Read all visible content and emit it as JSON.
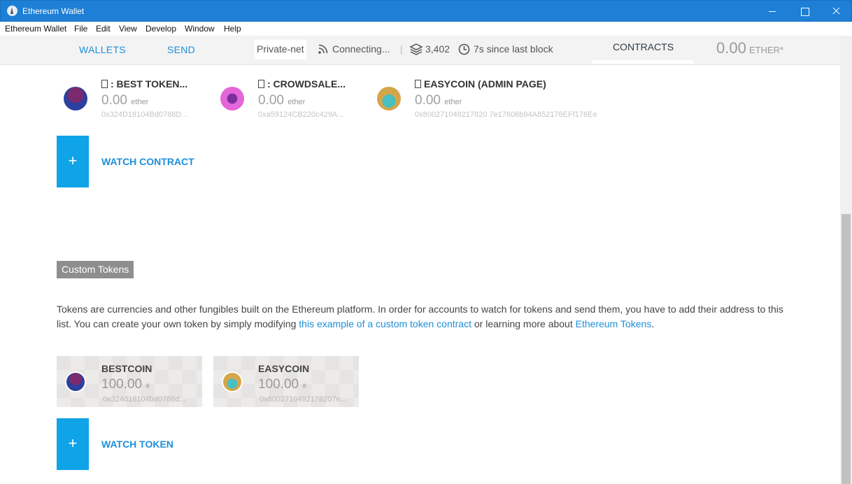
{
  "window": {
    "title": "Ethereum Wallet"
  },
  "menu": [
    "Ethereum Wallet",
    "File",
    "Edit",
    "View",
    "Develop",
    "Window",
    "Help"
  ],
  "nav": {
    "wallets": "WALLETS",
    "send": "SEND",
    "network": "Private-net",
    "connection": "Connecting...",
    "separator": "|",
    "block_number": "3,402",
    "last_block": "7s since last block",
    "contracts": "CONTRACTS",
    "balance": "0.00",
    "balance_unit": "ETHER*"
  },
  "contracts": [
    {
      "name": ": BEST TOKEN...",
      "amount": "0.00",
      "unit": "ether",
      "address": "0x324D18104Bd0788D..."
    },
    {
      "name": ": CROWDSALE...",
      "amount": "0.00",
      "unit": "ether",
      "address": "0xa59124CB220c429A..."
    },
    {
      "name": "EASYCOIN (ADMIN PAGE)",
      "amount": "0.00",
      "unit": "ether",
      "address": "0x800271049217820 7e17606b94A852176EFf176Ee"
    }
  ],
  "watch_contract": {
    "plus": "+",
    "label": "WATCH CONTRACT"
  },
  "custom_tokens": {
    "heading": "Custom Tokens",
    "desc_part1": "Tokens are currencies and other fungibles built on the Ethereum platform. In order for accounts to watch for tokens and send them, you have to add their address to this list. You can create your own token by simply modifying ",
    "link1": "this example of a custom token contract",
    "desc_part2": " or learning more about ",
    "link2": "Ethereum Tokens",
    "desc_part3": ".",
    "tokens": [
      {
        "name": "BESTCOIN",
        "amount": "100.00",
        "symbol": "#",
        "address": "0x324d18104bd0788d..."
      },
      {
        "name": "EASYCOIN",
        "amount": "100.00",
        "symbol": "#",
        "address": "0x8002710492178207e..."
      }
    ]
  },
  "watch_token": {
    "plus": "+",
    "label": "WATCH TOKEN"
  },
  "icons": [
    "ethereum-app-icon",
    "minimize-icon",
    "maximize-icon",
    "close-icon",
    "rss-icon",
    "layers-icon",
    "clock-icon",
    "document-icon"
  ]
}
